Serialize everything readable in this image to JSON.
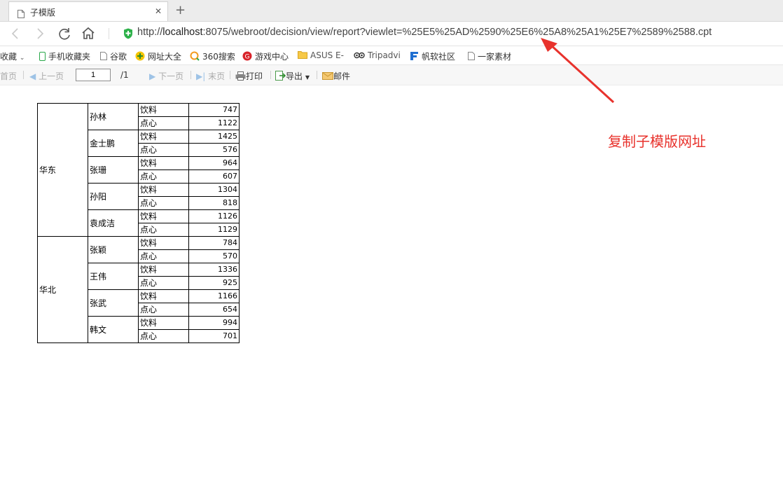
{
  "browser": {
    "tab_title": "子模版",
    "new_tab_symbol": "+",
    "url_scheme": "http://",
    "url_host": "localhost",
    "url_rest": ":8075/webroot/decision/view/report?viewlet=%25E5%25AD%2590%25E6%25A8%25A1%25E7%2589%2588.cpt"
  },
  "bookmarks": [
    {
      "label": "收藏",
      "icon": "star-icon"
    },
    {
      "label": "手机收藏夹",
      "icon": "phone-icon"
    },
    {
      "label": "谷歌",
      "icon": "doc-icon"
    },
    {
      "label": "网址大全",
      "icon": "globe-icon"
    },
    {
      "label": "360搜索",
      "icon": "search-icon"
    },
    {
      "label": "游戏中心",
      "icon": "game-icon"
    },
    {
      "label": "ASUS E-",
      "icon": "folder-icon"
    },
    {
      "label": "Tripadvi",
      "icon": "owl-icon"
    },
    {
      "label": "帆软社区",
      "icon": "fanruan-icon"
    },
    {
      "label": "一家素材",
      "icon": "doc-icon"
    }
  ],
  "toolbar": {
    "first": "首页",
    "prev": "上一页",
    "page_value": "1",
    "page_total": "/1",
    "next": "下一页",
    "last": "末页",
    "print": "打印",
    "export": "导出",
    "mail": "邮件"
  },
  "report": {
    "regions": [
      {
        "name": "华东",
        "people": [
          {
            "name": "孙林",
            "rows": [
              {
                "cat": "饮料",
                "val": "747"
              },
              {
                "cat": "点心",
                "val": "1122"
              }
            ]
          },
          {
            "name": "金士鹏",
            "rows": [
              {
                "cat": "饮料",
                "val": "1425"
              },
              {
                "cat": "点心",
                "val": "576"
              }
            ]
          },
          {
            "name": "张珊",
            "rows": [
              {
                "cat": "饮料",
                "val": "964"
              },
              {
                "cat": "点心",
                "val": "607"
              }
            ]
          },
          {
            "name": "孙阳",
            "rows": [
              {
                "cat": "饮料",
                "val": "1304"
              },
              {
                "cat": "点心",
                "val": "818"
              }
            ]
          },
          {
            "name": "袁成洁",
            "rows": [
              {
                "cat": "饮料",
                "val": "1126"
              },
              {
                "cat": "点心",
                "val": "1129"
              }
            ]
          }
        ]
      },
      {
        "name": "华北",
        "people": [
          {
            "name": "张颖",
            "rows": [
              {
                "cat": "饮料",
                "val": "784"
              },
              {
                "cat": "点心",
                "val": "570"
              }
            ]
          },
          {
            "name": "王伟",
            "rows": [
              {
                "cat": "饮料",
                "val": "1336"
              },
              {
                "cat": "点心",
                "val": "925"
              }
            ]
          },
          {
            "name": "张武",
            "rows": [
              {
                "cat": "饮料",
                "val": "1166"
              },
              {
                "cat": "点心",
                "val": "654"
              }
            ]
          },
          {
            "name": "韩文",
            "rows": [
              {
                "cat": "饮料",
                "val": "994"
              },
              {
                "cat": "点心",
                "val": "701"
              }
            ]
          }
        ]
      }
    ]
  },
  "annotation": {
    "text": "复制子模版网址",
    "color": "#e8322c"
  }
}
